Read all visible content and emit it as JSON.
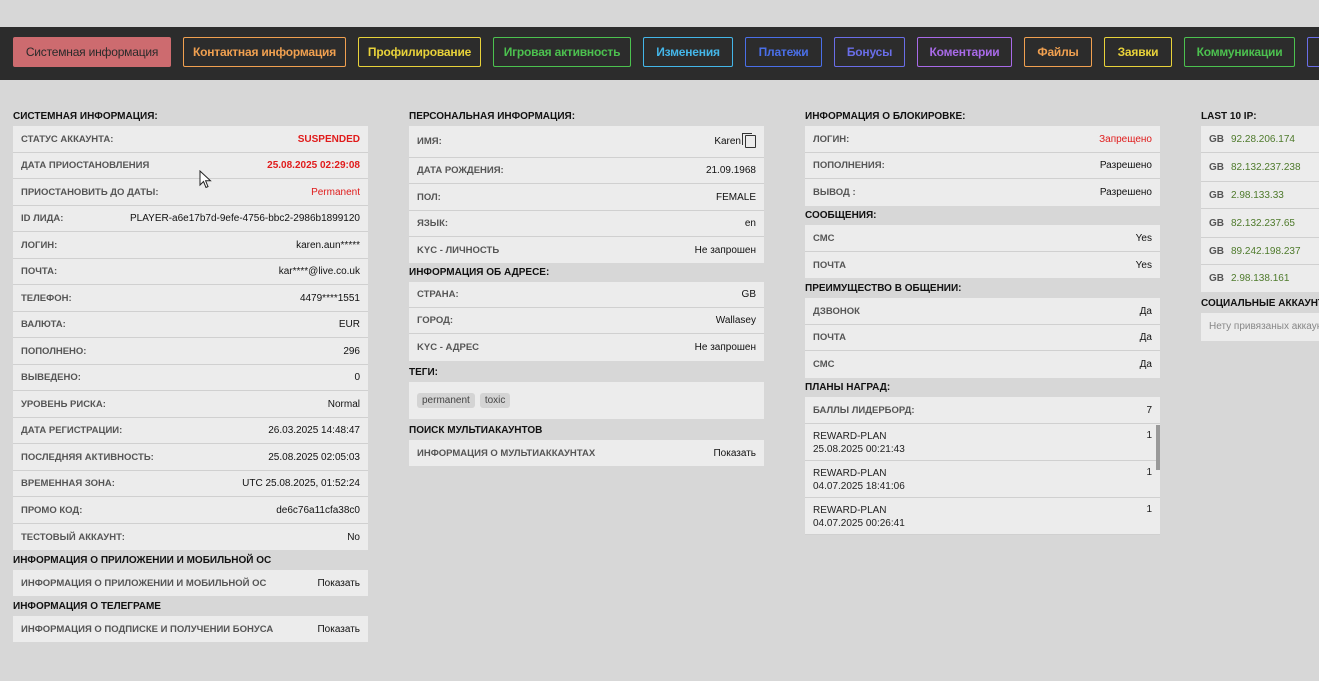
{
  "tabs": [
    {
      "label": "Системная информация",
      "color": "#cd6b6f"
    },
    {
      "label": "Контактная информация",
      "color": "#f0a050"
    },
    {
      "label": "Профилирование",
      "color": "#e8d23a"
    },
    {
      "label": "Игровая активность",
      "color": "#4cc14f"
    },
    {
      "label": "Изменения",
      "color": "#44b6e8"
    },
    {
      "label": "Платежи",
      "color": "#4a6fe8"
    },
    {
      "label": "Бонусы",
      "color": "#6a6ee8"
    },
    {
      "label": "Коментарии",
      "color": "#a86ae8"
    },
    {
      "label": "Файлы",
      "color": "#f0a050"
    },
    {
      "label": "Заявки",
      "color": "#e8d23a"
    },
    {
      "label": "Коммуникации",
      "color": "#4cc14f"
    }
  ],
  "system": {
    "title": "СИСТЕМНАЯ ИНФОРМАЦИЯ:",
    "rows": [
      {
        "label": "СТАТУС АККАУНТА:",
        "value": "SUSPENDED"
      },
      {
        "label": "ДАТА ПРИОСТАНОВЛЕНИЯ",
        "value": "25.08.2025 02:29:08"
      },
      {
        "label": "ПРИОСТАНОВИТЬ ДО ДАТЫ:",
        "value": "Permanent"
      },
      {
        "label": "ID ЛИДА:",
        "value": "PLAYER-a6e17b7d-9efe-4756-bbc2-2986b1899120"
      },
      {
        "label": "ЛОГИН:",
        "value": "karen.aun*****"
      },
      {
        "label": "ПОЧТА:",
        "value": "kar****@live.co.uk"
      },
      {
        "label": "ТЕЛЕФОН:",
        "value": "4479****1551"
      },
      {
        "label": "ВАЛЮТА:",
        "value": "EUR"
      },
      {
        "label": "ПОПОЛНЕНО:",
        "value": "296"
      },
      {
        "label": "ВЫВЕДЕНО:",
        "value": "0"
      },
      {
        "label": "УРОВЕНЬ РИСКА:",
        "value": "Normal"
      },
      {
        "label": "ДАТА РЕГИСТРАЦИИ:",
        "value": "26.03.2025 14:48:47"
      },
      {
        "label": "ПОСЛЕДНЯЯ АКТИВНОСТЬ:",
        "value": "25.08.2025 02:05:03"
      },
      {
        "label": "ВРЕМЕННАЯ ЗОНА:",
        "value": "UTC 25.08.2025, 01:52:24"
      },
      {
        "label": "ПРОМО КОД:",
        "value": "de6c76a11cfa38c0"
      },
      {
        "label": "ТЕСТОВЫЙ АККАУНТ:",
        "value": "No"
      }
    ],
    "app_title": "ИНФОРМАЦИЯ О ПРИЛОЖЕНИИ И МОБИЛЬНОЙ ОС",
    "app_row": {
      "label": "ИНФОРМАЦИЯ О ПРИЛОЖЕНИИ И МОБИЛЬНОЙ ОС",
      "value": "Показать"
    },
    "tg_title": "ИНФОРМАЦИЯ О ТЕЛЕГРАМЕ",
    "tg_row": {
      "label": "ИНФОРМАЦИЯ О ПОДПИСКЕ И ПОЛУЧЕНИИ БОНУСА",
      "value": "Показать"
    }
  },
  "personal": {
    "title": "ПЕРСОНАЛЬНАЯ ИНФОРМАЦИЯ:",
    "rows": [
      {
        "label": "ИМЯ:",
        "value": "Karen"
      },
      {
        "label": "ДАТА РОЖДЕНИЯ:",
        "value": "21.09.1968"
      },
      {
        "label": "ПОЛ:",
        "value": "FEMALE"
      },
      {
        "label": "ЯЗЫК:",
        "value": "en"
      },
      {
        "label": "KYC - ЛИЧНОСТЬ",
        "value": "Не запрошен"
      }
    ],
    "address_title": "ИНФОРМАЦИЯ ОБ АДРЕСЕ:",
    "address_rows": [
      {
        "label": "СТРАНА:",
        "value": "GB"
      },
      {
        "label": "ГОРОД:",
        "value": "Wallasey"
      },
      {
        "label": "KYC - АДРЕС",
        "value": "Не запрошен"
      }
    ],
    "tags_title": "ТЕГИ:",
    "tags": [
      "permanent",
      "toxic"
    ],
    "multi_title": "ПОИСК МУЛЬТИАКАУНТОВ",
    "multi_row": {
      "label": "ИНФОРМАЦИЯ О МУЛЬТИАККАУНТАХ",
      "value": "Показать"
    }
  },
  "blocking": {
    "title": "ИНФОРМАЦИЯ О БЛОКИРОВКЕ:",
    "rows": [
      {
        "label": "ЛОГИН:",
        "value": "Запрещено"
      },
      {
        "label": "ПОПОЛНЕНИЯ:",
        "value": "Разрешено"
      },
      {
        "label": "ВЫВОД :",
        "value": "Разрешено"
      }
    ],
    "messages_title": "СООБЩЕНИЯ:",
    "messages_rows": [
      {
        "label": "СМС",
        "value": "Yes"
      },
      {
        "label": "ПОЧТА",
        "value": "Yes"
      }
    ],
    "pref_title": "ПРЕИМУЩЕСТВО В ОБЩЕНИИ:",
    "pref_rows": [
      {
        "label": "ДЗВОНОК",
        "value": "Да"
      },
      {
        "label": "ПОЧТА",
        "value": "Да"
      },
      {
        "label": "СМС",
        "value": "Да"
      }
    ],
    "rewards_title": "ПЛАНЫ НАГРАД:",
    "leaderboard": {
      "label": "БАЛЛЫ ЛИДЕРБОРД:",
      "value": "7"
    },
    "rewards": [
      {
        "name": "REWARD-PLAN",
        "date": "25.08.2025 00:21:43",
        "count": "1"
      },
      {
        "name": "REWARD-PLAN",
        "date": "04.07.2025 18:41:06",
        "count": "1"
      },
      {
        "name": "REWARD-PLAN",
        "date": "04.07.2025 00:26:41",
        "count": "1"
      }
    ]
  },
  "ips": {
    "title": "LAST 10 IP:",
    "rows": [
      {
        "cc": "GB",
        "ip": "92.28.206.174"
      },
      {
        "cc": "GB",
        "ip": "82.132.237.238"
      },
      {
        "cc": "GB",
        "ip": "2.98.133.33"
      },
      {
        "cc": "GB",
        "ip": "82.132.237.65"
      },
      {
        "cc": "GB",
        "ip": "89.242.198.237"
      },
      {
        "cc": "GB",
        "ip": "2.98.138.161"
      }
    ],
    "social_title": "СОЦИАЛЬНЫЕ АККАУНТЫ",
    "social_empty": "Нету привязаных аккаунтов"
  }
}
